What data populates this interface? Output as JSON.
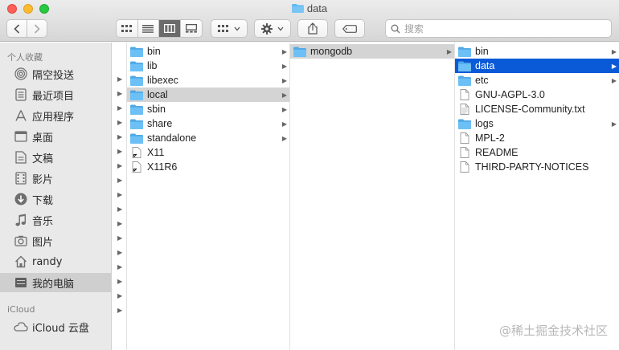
{
  "window": {
    "title": "data"
  },
  "search": {
    "placeholder": "搜索"
  },
  "sidebar": {
    "favorites_header": "个人收藏",
    "favorites": [
      {
        "label": "隔空投送",
        "icon": "airdrop-icon"
      },
      {
        "label": "最近项目",
        "icon": "recents-icon"
      },
      {
        "label": "应用程序",
        "icon": "applications-icon"
      },
      {
        "label": "桌面",
        "icon": "desktop-icon"
      },
      {
        "label": "文稿",
        "icon": "documents-icon"
      },
      {
        "label": "影片",
        "icon": "movies-icon"
      },
      {
        "label": "下载",
        "icon": "downloads-icon"
      },
      {
        "label": "音乐",
        "icon": "music-icon"
      },
      {
        "label": "图片",
        "icon": "pictures-icon"
      },
      {
        "label": "randy",
        "icon": "home-icon"
      },
      {
        "label": "我的电脑",
        "icon": "computer-icon",
        "selected": true
      }
    ],
    "icloud_header": "iCloud",
    "icloud": [
      {
        "label": "iCloud 云盘",
        "icon": "cloud-icon"
      }
    ]
  },
  "columns": {
    "usr": [
      {
        "name": "bin",
        "type": "folder"
      },
      {
        "name": "lib",
        "type": "folder"
      },
      {
        "name": "libexec",
        "type": "folder"
      },
      {
        "name": "local",
        "type": "folder",
        "selected": "gray"
      },
      {
        "name": "sbin",
        "type": "folder"
      },
      {
        "name": "share",
        "type": "folder"
      },
      {
        "name": "standalone",
        "type": "folder"
      },
      {
        "name": "X11",
        "type": "alias"
      },
      {
        "name": "X11R6",
        "type": "alias"
      }
    ],
    "local": [
      {
        "name": "mongodb",
        "type": "folder",
        "selected": "gray"
      }
    ],
    "mongodb": [
      {
        "name": "bin",
        "type": "folder"
      },
      {
        "name": "data",
        "type": "folder",
        "selected": "blue"
      },
      {
        "name": "etc",
        "type": "folder"
      },
      {
        "name": "GNU-AGPL-3.0",
        "type": "file"
      },
      {
        "name": "LICENSE-Community.txt",
        "type": "file"
      },
      {
        "name": "logs",
        "type": "folder"
      },
      {
        "name": "MPL-2",
        "type": "file"
      },
      {
        "name": "README",
        "type": "file"
      },
      {
        "name": "THIRD-PARTY-NOTICES",
        "type": "file"
      }
    ]
  },
  "watermark": "@稀土掘金技术社区",
  "colors": {
    "selection_blue": "#0a5ad7",
    "folder_blue": "#5cb8f2"
  }
}
